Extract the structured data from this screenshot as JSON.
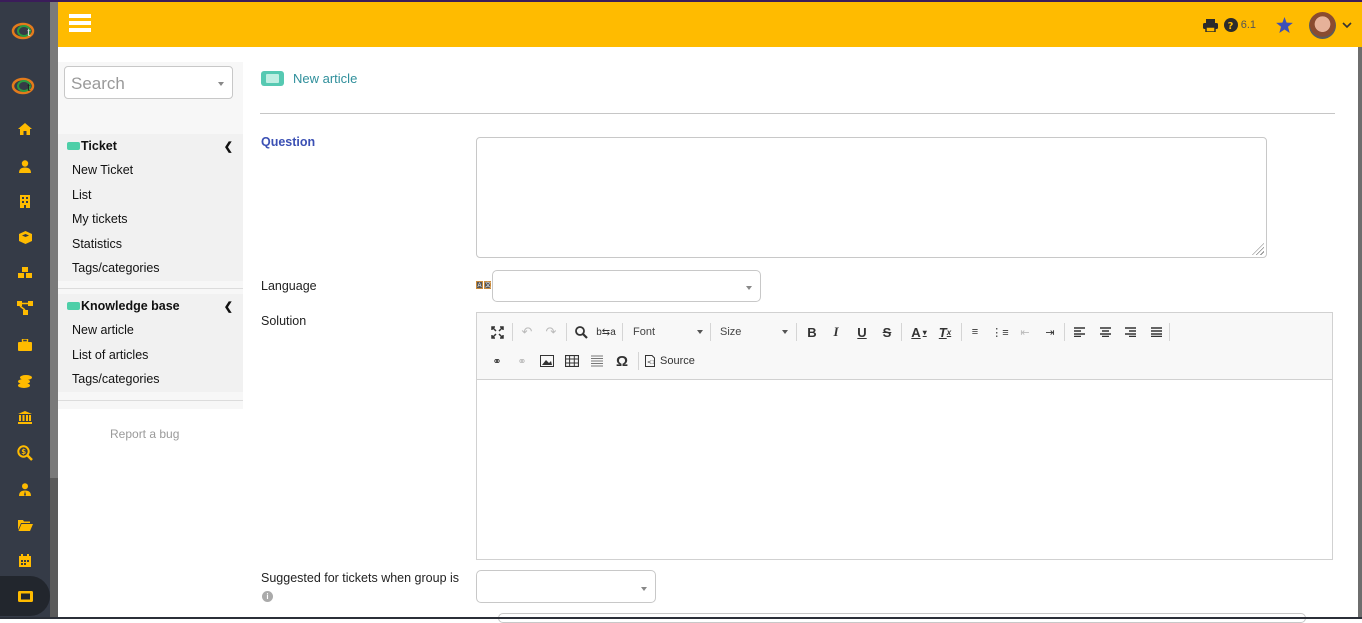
{
  "header": {
    "version": "6.1",
    "icons": [
      "menu-icon",
      "printer-icon",
      "help-icon",
      "star-icon",
      "user-avatar",
      "chevron-down-icon"
    ]
  },
  "rail": {
    "icons": [
      "home-icon",
      "user-icon",
      "building-icon",
      "box-icon",
      "cubes-icon",
      "sitemap-icon",
      "briefcase-icon",
      "coins-icon",
      "bank-icon",
      "search-dollar-icon",
      "user-tie-icon",
      "folder-open-icon",
      "calendar-icon",
      "ticket-icon"
    ],
    "active": "ticket-icon"
  },
  "sidebar": {
    "search_placeholder": "Search",
    "sections": [
      {
        "title": "Ticket",
        "items": [
          "New Ticket",
          "List",
          "My tickets",
          "Statistics",
          "Tags/categories"
        ]
      },
      {
        "title": "Knowledge base",
        "items": [
          "New article",
          "List of articles",
          "Tags/categories"
        ]
      }
    ],
    "report_bug": "Report a bug"
  },
  "main": {
    "page_title": "New article",
    "question_label": "Question",
    "question_value": "",
    "language_label": "Language",
    "language_value": "",
    "solution_label": "Solution",
    "editor": {
      "font_label": "Font",
      "size_label": "Size",
      "source_label": "Source",
      "content": ""
    },
    "suggested_label": "Suggested for tickets when group is",
    "suggested_value": ""
  },
  "colors": {
    "header": "#ffbb00",
    "rail": "#353b47",
    "rail_icon": "#ffbb00",
    "title": "#2f8f9b",
    "question_label": "#3b50b4",
    "ticket_tag": "#4ecfa8"
  }
}
